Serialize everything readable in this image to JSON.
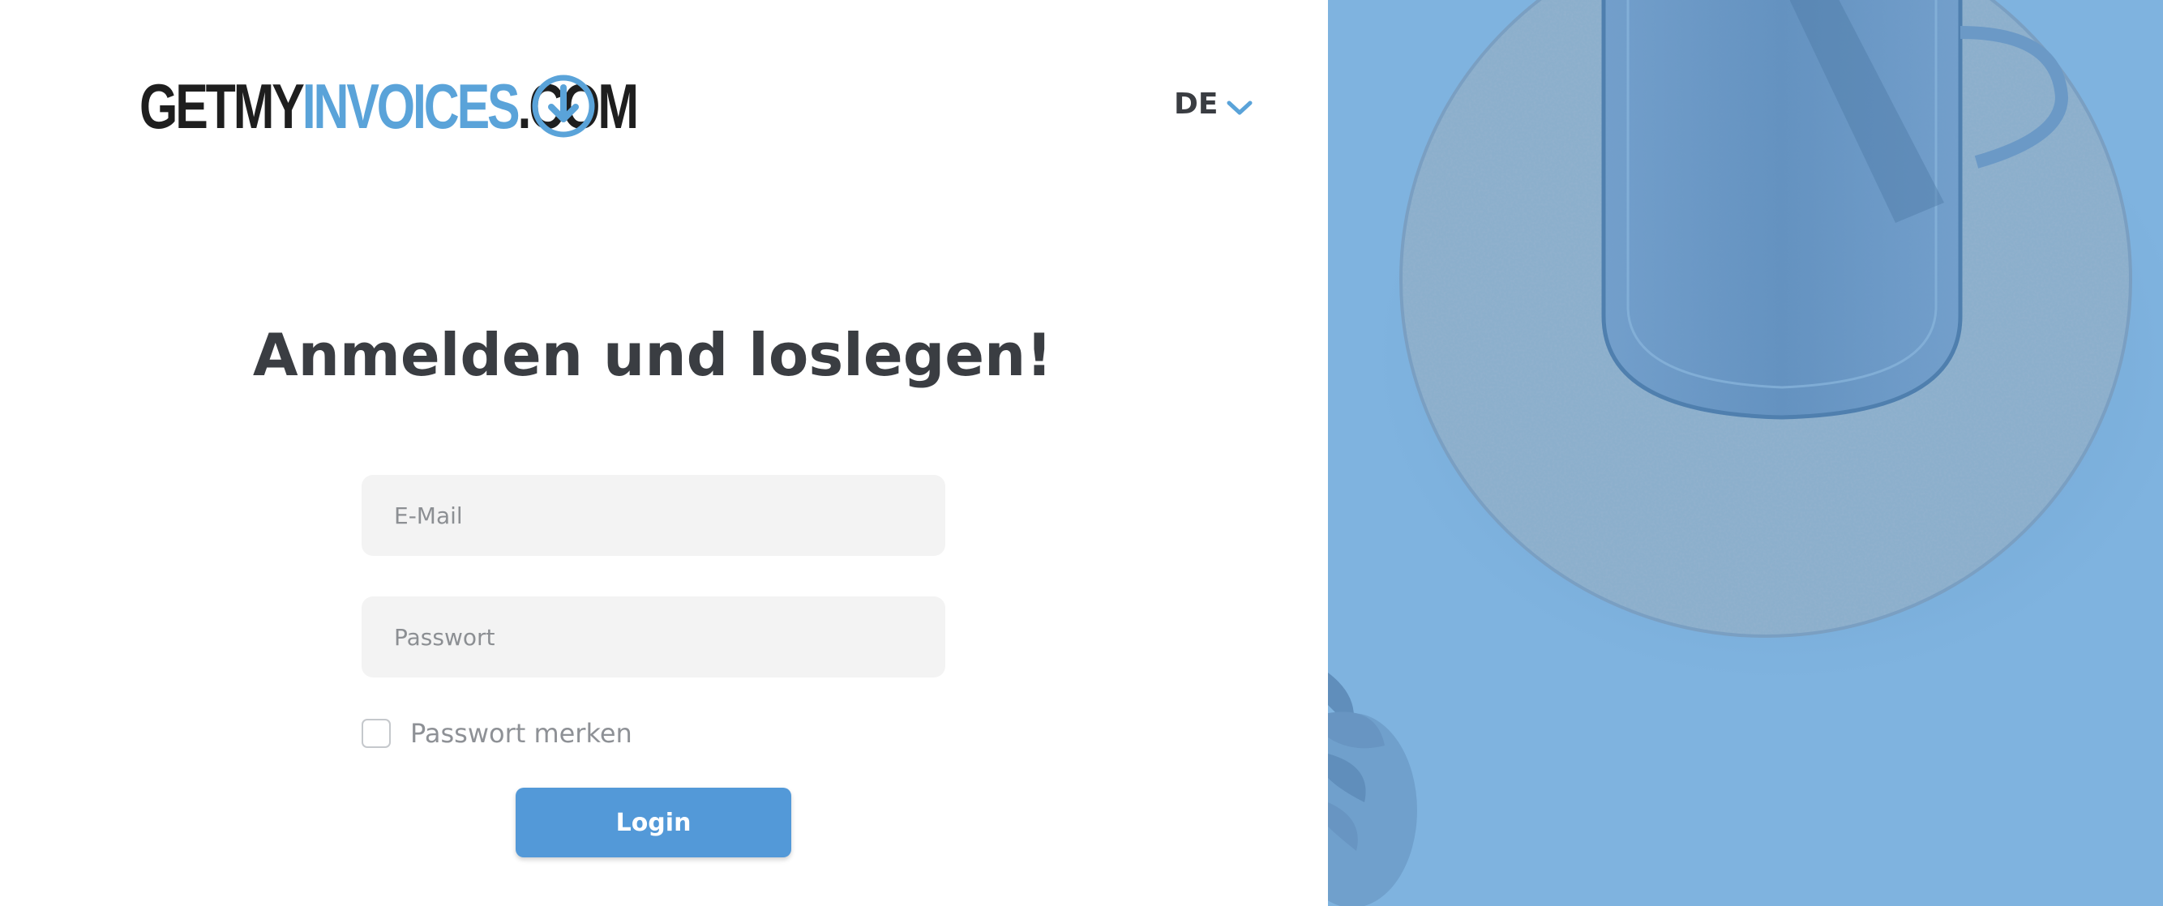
{
  "logo": {
    "part1": "GETMY",
    "part2": "INVOICES",
    "part3": ".COM",
    "icon": "download-circle-icon"
  },
  "language": {
    "selected": "DE",
    "icon": "chevron-down-icon"
  },
  "heading": "Anmelden und loslegen!",
  "form": {
    "email_placeholder": "E-Mail",
    "email_value": "",
    "password_placeholder": "Passwort",
    "password_value": "",
    "remember_label": "Passwort merken",
    "remember_checked": false,
    "login_label": "Login"
  },
  "hero_image": {
    "description_icon": "glass-on-cork-coaster-photo"
  },
  "colors": {
    "brand_blue": "#5aa3d9",
    "button_blue": "#5399d8",
    "heading_text": "#3a3d42",
    "input_bg": "#f3f3f3",
    "overlay_blue": "#7fb3df"
  }
}
